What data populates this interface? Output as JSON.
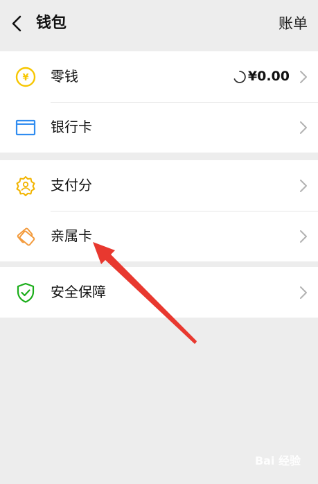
{
  "header": {
    "title": "钱包",
    "bill_label": "账单"
  },
  "sections": [
    {
      "items": [
        {
          "label": "零钱",
          "icon": "coin-icon",
          "value": "¥0.00"
        },
        {
          "label": "银行卡",
          "icon": "bank-card-icon"
        }
      ]
    },
    {
      "items": [
        {
          "label": "支付分",
          "icon": "pay-score-icon"
        },
        {
          "label": "亲属卡",
          "icon": "family-card-icon"
        }
      ]
    },
    {
      "items": [
        {
          "label": "安全保障",
          "icon": "shield-icon"
        }
      ]
    }
  ],
  "colors": {
    "background": "#ededed",
    "coin_yellow": "#f7c600",
    "card_blue": "#2f8cf0",
    "paysc_yellow": "#f2b400",
    "family_orange": "#f39a3b",
    "shield_green": "#1aad19",
    "arrow_red": "#e8382f"
  },
  "watermark": "Bai 经验"
}
